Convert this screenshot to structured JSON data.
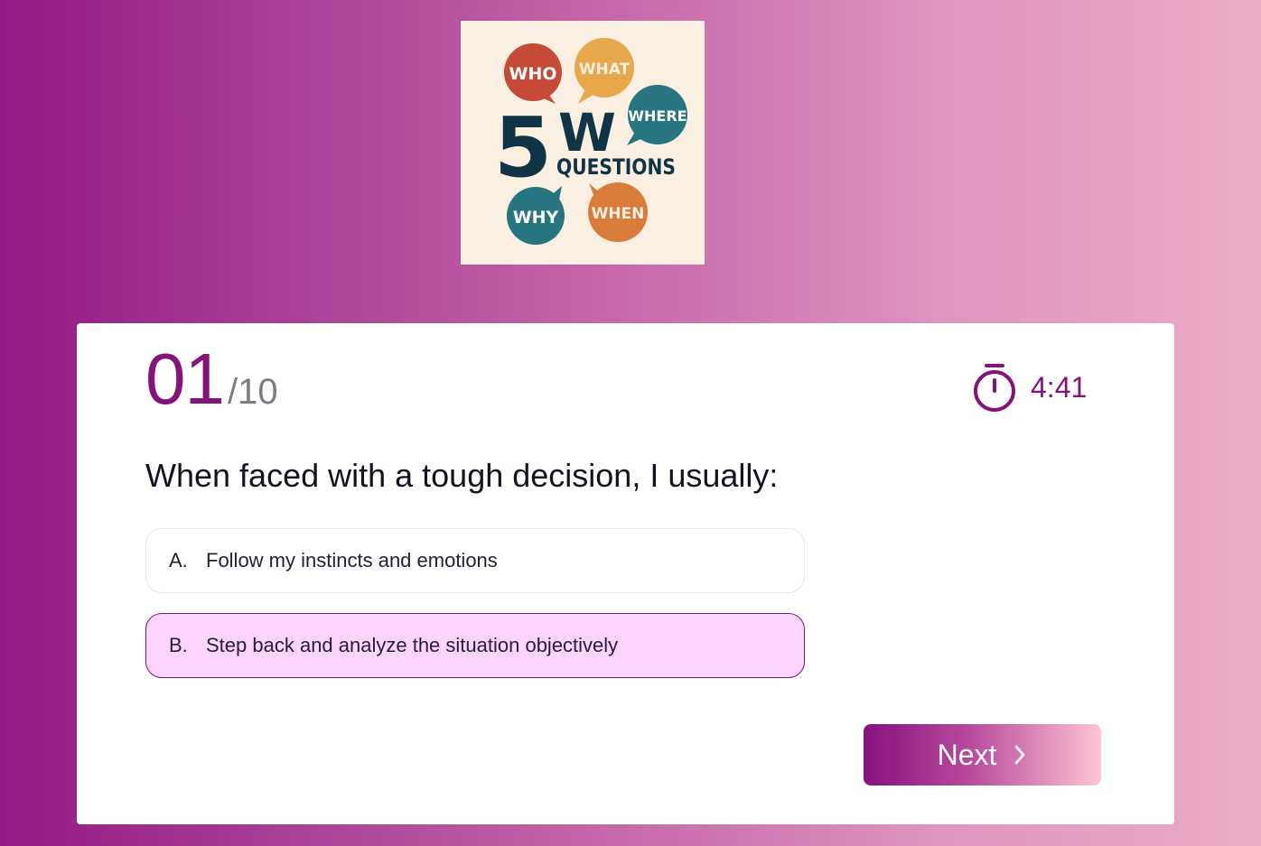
{
  "logo": {
    "bubbles": [
      "WHO",
      "WHAT",
      "WHERE",
      "WHY",
      "WHEN"
    ],
    "big_number": "5",
    "big_letter": "W",
    "word": "QUESTIONS"
  },
  "quiz": {
    "current": "01",
    "total": "/10",
    "timer": "4:41",
    "question": "When faced with a tough decision, I usually:",
    "options": [
      {
        "letter": "A.",
        "text": "Follow my instincts and emotions",
        "selected": false
      },
      {
        "letter": "B.",
        "text": "Step back and analyze the situation objectively",
        "selected": true
      }
    ],
    "next_label": "Next"
  },
  "colors": {
    "accent": "#86127e",
    "selected_bg": "#fdd4ff",
    "bubble_red": "#c64a38",
    "bubble_yellow": "#e6a84a",
    "bubble_teal": "#267580",
    "bubble_orange": "#d97c3a",
    "logo_text": "#0f3446"
  },
  "icons": {
    "timer": "stopwatch-icon",
    "next": "chevron-right-icon"
  }
}
